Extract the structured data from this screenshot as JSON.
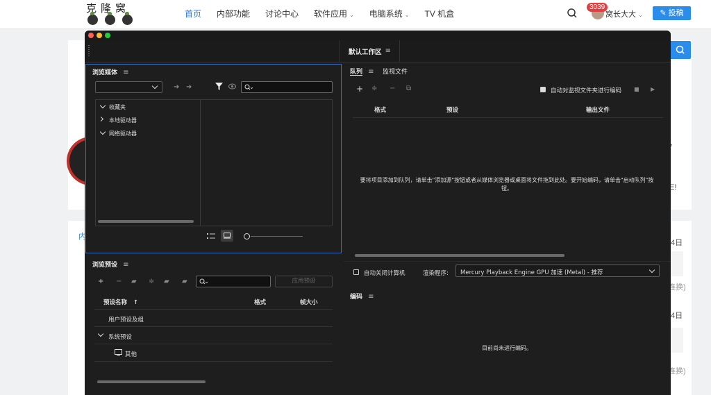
{
  "site": {
    "logo_text": "克隆窝",
    "nav": [
      {
        "label": "首页",
        "caret": ""
      },
      {
        "label": "内部功能",
        "caret": ""
      },
      {
        "label": "讨论中心",
        "caret": ""
      },
      {
        "label": "软件应用",
        "caret": "⌄"
      },
      {
        "label": "电脑系统",
        "caret": "⌄"
      },
      {
        "label": "TV 机盒",
        "caret": ""
      }
    ],
    "notification_count": "3039",
    "username": "窝长大大",
    "post_button": "投稿",
    "bg_snippets": {
      "left_tab": "内",
      "comma": "，",
      "exclaim": "E!",
      "day1": "4日",
      "swap1": "连换)",
      "day2": "4日",
      "swap2": "连换)"
    }
  },
  "app": {
    "workspace_title": "默认工作区",
    "media_browser": {
      "title": "浏览媒体",
      "tree": [
        {
          "label": "收藏夹",
          "expanded": true
        },
        {
          "label": "本地驱动器",
          "expanded": false
        },
        {
          "label": "网络驱动器",
          "expanded": true
        }
      ]
    },
    "preset_browser": {
      "title": "浏览预设",
      "apply_button": "应用预设",
      "columns": {
        "name": "预设名称",
        "sort_arrow": "↑",
        "format": "格式",
        "frame_size": "帧大小"
      },
      "rows": [
        {
          "label": "用户预设及组"
        },
        {
          "label": "系统预设"
        },
        {
          "label": "其他"
        }
      ]
    },
    "queue": {
      "tabs": [
        {
          "label": "队列"
        },
        {
          "label": "监视文件"
        }
      ],
      "auto_encode_label": "自动对监视文件夹进行编码",
      "auto_encode_checked": true,
      "columns": {
        "format": "格式",
        "preset": "预设",
        "output": "输出文件"
      },
      "empty_message": "要将项目添加到队列，请单击\"添加源\"按钮或者从媒体浏览器或桌面将文件拖到此处。要开始编码，请单击\"启动队列\"按钮。",
      "auto_shutdown_label": "自动关闭计算机",
      "renderer_label": "渲染程序:",
      "renderer_value": "Mercury Playback Engine GPU 加速 (Metal) - 推荐"
    },
    "encoding": {
      "title": "编码",
      "empty_message": "目前尚未进行编码。"
    }
  }
}
